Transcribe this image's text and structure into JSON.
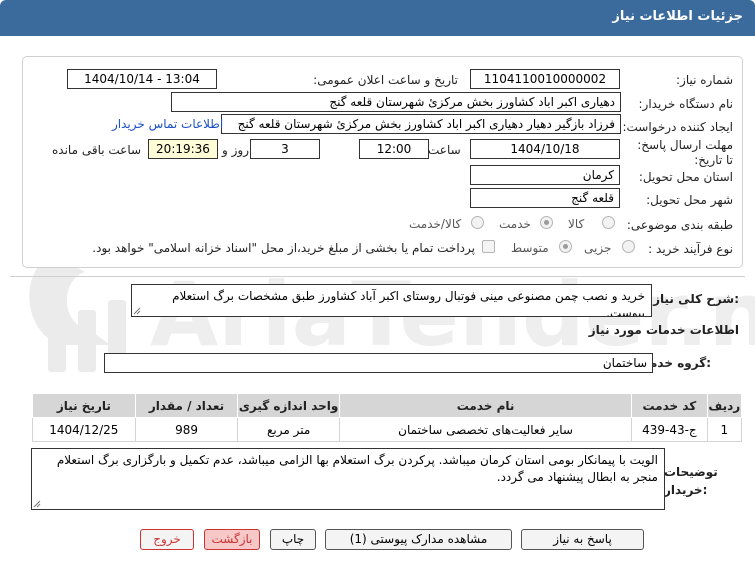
{
  "header": {
    "title": "جزئیات اطلاعات نیاز"
  },
  "fields": {
    "need_number_label": "شماره نیاز:",
    "need_number": "1104110010000002",
    "announce_label": "تاریخ و ساعت اعلان عمومی:",
    "announce_value": "1404/10/14 - 13:04",
    "buyer_org_label": "نام دستگاه خریدار:",
    "buyer_org": "دهیاری اکبر اباد کشاورز بخش مرکزئ شهرستان قلعه گنج",
    "requester_label": "ایجاد کننده درخواست:",
    "requester": "فرزاد بازگیر دهیار دهیاری اکبر اباد کشاورز بخش مرکزئ شهرستان قلعه گنج",
    "contact_link": "اطلاعات تماس خریدار",
    "deadline_label": "مهلت ارسال پاسخ: تا تاریخ:",
    "deadline_date": "1404/10/18",
    "time_label": "ساعت",
    "deadline_time": "12:00",
    "days_value": "3",
    "days_label": "روز و",
    "remaining_time": "20:19:36",
    "remaining_label": "ساعت باقی مانده",
    "province_label": "استان محل تحویل:",
    "province": "کرمان",
    "city_label": "شهر محل تحویل:",
    "city": "قلعه گنج",
    "category_label": "طبقه بندی موضوعی:",
    "category_options": [
      "کالا",
      "خدمت",
      "کالا/خدمت"
    ],
    "category_selected": "خدمت",
    "process_label": "نوع فرآیند خرید :",
    "process_options": [
      "جزیی",
      "متوسط"
    ],
    "process_selected": "متوسط",
    "treasury_note": "پرداخت تمام یا بخشی از مبلغ خرید،از محل \"اسناد خزانه اسلامی\" خواهد بود."
  },
  "description": {
    "label": "شرح کلی نیاز:",
    "text": "خرید و نصب چمن مصنوعی مینی فوتبال روستای اکبر آباد کشاورز طبق مشخصات برگ استعلام پیوست."
  },
  "services": {
    "section_title": "اطلاعات خدمات مورد نیاز",
    "group_label": "گروه خدمت:",
    "group_value": "ساختمان",
    "columns": [
      "ردیف",
      "کد خدمت",
      "نام خدمت",
      "واحد اندازه گیری",
      "تعداد / مقدار",
      "تاریخ نیاز"
    ],
    "rows": [
      [
        "1",
        "ج-43-439",
        "سایر فعالیت‌های تخصصی ساختمان",
        "متر مربع",
        "989",
        "1404/12/25"
      ]
    ]
  },
  "buyer_notes": {
    "label": "توضیحات خریدار:",
    "text": "الویت با پیمانکار بومی استان کرمان میباشد. پرکردن برگ استعلام بها الزامی میباشد، عدم تکمیل و بارگزاری برگ استعلام منجر به ابطال پیشنهاد می گردد."
  },
  "buttons": {
    "reply": "پاسخ به نیاز",
    "attachments": "مشاهده مدارک پیوستی (1)",
    "print": "چاپ",
    "back": "بازگشت",
    "exit": "خروج"
  },
  "colors": {
    "header_bg": "#3a6b9c",
    "link": "#1a4fc7",
    "time_bg": "#fefcd7",
    "exit_red": "#cc3333"
  }
}
